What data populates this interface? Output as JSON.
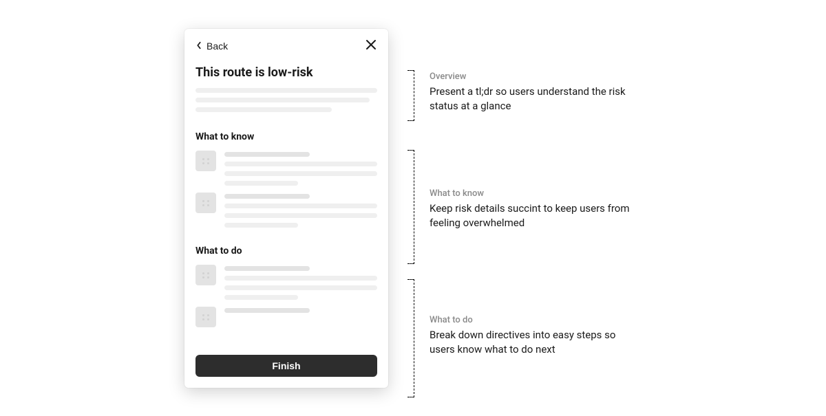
{
  "card": {
    "back_label": "Back",
    "title": "This route is low-risk",
    "sections": {
      "know_heading": "What to know",
      "do_heading": "What to do"
    },
    "finish_label": "Finish"
  },
  "annotations": {
    "overview": {
      "label": "Overview",
      "body": "Present a tl;dr so users understand the risk status at a glance"
    },
    "know": {
      "label": "What to know",
      "body": "Keep risk details succint to keep users from feeling overwhelmed"
    },
    "do": {
      "label": "What to do",
      "body": "Break down directives into easy steps so users know what to do next"
    }
  }
}
